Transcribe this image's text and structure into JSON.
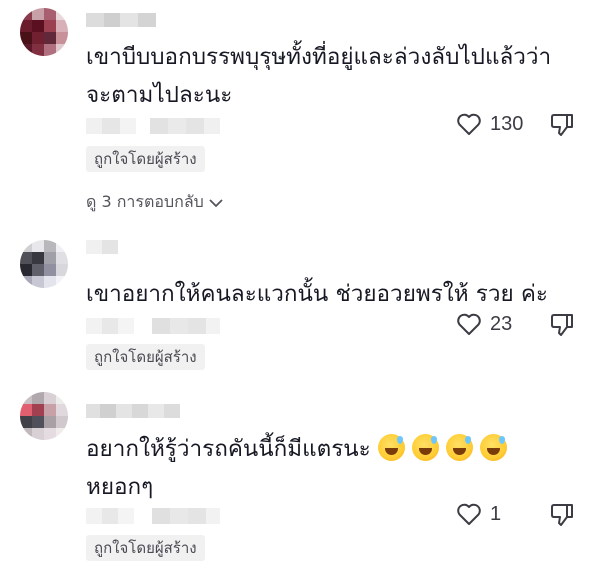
{
  "comments": [
    {
      "text": "เขาบีบบอกบรรพบุรุษทั้งที่อยู่และล่วงลับไปแล้วว่า\nจะตามไปละนะ",
      "likes": "130",
      "badge": "ถูกใจโดยผู้สร้าง",
      "replies": "ดู 3 การตอบกลับ",
      "icons": {
        "like": "heart-icon",
        "dislike": "thumbs-down-icon",
        "expand": "chevron-down-icon"
      }
    },
    {
      "text": "เขาอยากให้คนละแวกนั้น ช่วยอวยพรให้ รวย ค่ะ",
      "likes": "23",
      "badge": "ถูกใจโดยผู้สร้าง"
    },
    {
      "text": "อยากให้รู้ว่ารถคันนี้ก็มีแตรนะ",
      "text2": "หยอกๆ",
      "emoji": "grinning-face-with-sweat-emoji",
      "emoji_count": 4,
      "likes": "1",
      "badge": "ถูกใจโดยผู้สร้าง"
    }
  ],
  "colors": {
    "text": "#161823",
    "badge_bg": "#f1f1f2",
    "icon": "#3c3c44"
  }
}
